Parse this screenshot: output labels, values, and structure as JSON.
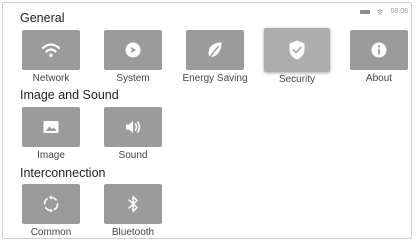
{
  "status": {
    "time": "08:08",
    "icons": [
      "battery-icon",
      "wifi-icon"
    ]
  },
  "sections": {
    "general": "General",
    "image_sound": "Image and Sound",
    "interconnection": "Interconnection"
  },
  "tiles": {
    "network": "Network",
    "system": "System",
    "energy": "Energy Saving",
    "security": "Security",
    "about": "About",
    "image": "Image",
    "sound": "Sound",
    "common": "Common",
    "bluetooth": "Bluetooth"
  },
  "selected": "security",
  "colors": {
    "tile": "#9b9b9b",
    "tile_selected": "#adadad",
    "icon": "#ffffff"
  }
}
